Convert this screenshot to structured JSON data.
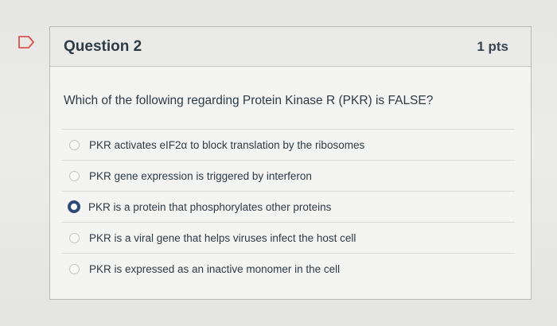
{
  "icons": {
    "flag": "flag-outline-icon",
    "radio": "radio-button-icon"
  },
  "colors": {
    "accent": "#2e4a79",
    "text": "#2d3b45"
  },
  "question": {
    "title": "Question 2",
    "points": "1 pts",
    "text": "Which of the following regarding Protein Kinase R (PKR) is FALSE?",
    "answers": [
      {
        "label": "PKR activates eIF2α to block translation by the ribosomes",
        "selected": false
      },
      {
        "label": "PKR gene expression is triggered by interferon",
        "selected": false
      },
      {
        "label": "PKR is a protein that phosphorylates other proteins",
        "selected": true
      },
      {
        "label": "PKR is a viral gene that helps viruses infect the host cell",
        "selected": false
      },
      {
        "label": "PKR is expressed as an inactive monomer in the cell",
        "selected": false
      }
    ]
  }
}
